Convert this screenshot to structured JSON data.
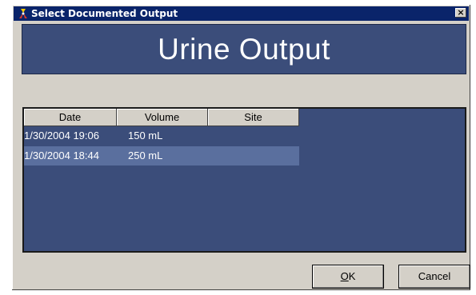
{
  "window": {
    "title": "Select Documented Output",
    "close_label": "×"
  },
  "banner": {
    "title": "Urine Output"
  },
  "table": {
    "columns": [
      "Date",
      "Volume",
      "Site"
    ],
    "rows": [
      {
        "date": "1/30/2004 19:06",
        "volume": "150 mL",
        "site": "",
        "selected": false
      },
      {
        "date": "1/30/2004 18:44",
        "volume": "250 mL",
        "site": "",
        "selected": true
      }
    ]
  },
  "buttons": {
    "ok_mnemonic": "O",
    "ok_rest": "K",
    "cancel_label": "Cancel"
  },
  "colors": {
    "titlebar": "#0a246a",
    "banner": "#3b4d7a",
    "selected_row": "#5a6f9e",
    "dialog_face": "#d4d0c8"
  }
}
